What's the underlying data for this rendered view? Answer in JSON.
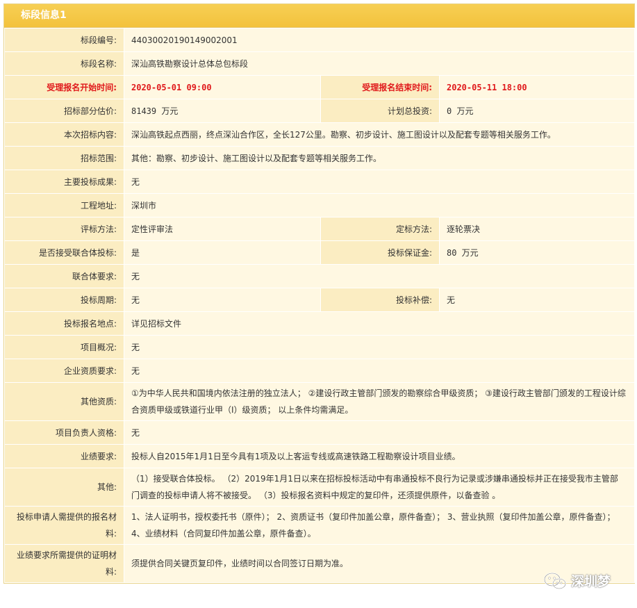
{
  "panel": {
    "title": "标段信息1"
  },
  "rows": [
    {
      "label": "标段编号:",
      "value": "44030020190149002001"
    },
    {
      "label": "标段名称:",
      "value": "深汕高铁勘察设计总体总包标段"
    },
    {
      "label": "受理报名开始时间:",
      "value": "2020-05-01  09:00",
      "label2": "受理报名结束时间:",
      "value2": "2020-05-11  18:00"
    },
    {
      "label": "招标部分估价:",
      "value": "81439 万元",
      "label2": "计划总投资:",
      "value2": "0 万元"
    },
    {
      "label": "本次招标内容:",
      "value": "深汕高铁起点西丽，终点深汕合作区，全长127公里。勘察、初步设计、施工图设计以及配套专题等相关服务工作。"
    },
    {
      "label": "招标范围:",
      "value": "其他：勘察、初步设计、施工图设计以及配套专题等相关服务工作。"
    },
    {
      "label": "主要投标成果:",
      "value": "无"
    },
    {
      "label": "工程地址:",
      "value": "深圳市"
    },
    {
      "label": "评标方法:",
      "value": "定性评审法",
      "label2": "定标方法:",
      "value2": "逐轮票决"
    },
    {
      "label": "是否接受联合体投标:",
      "value": "是",
      "label2": "投标保证金:",
      "value2": "80 万元"
    },
    {
      "label": "联合体要求:",
      "value": "无"
    },
    {
      "label": "投标周期:",
      "value": "无",
      "label2": "投标补偿:",
      "value2": "无"
    },
    {
      "label": "投标报名地点:",
      "value": "详见招标文件"
    },
    {
      "label": "项目概况:",
      "value": "无"
    },
    {
      "label": "企业资质要求:",
      "value": "无"
    },
    {
      "label": "其他资质:",
      "value": "①为中华人民共和国境内依法注册的独立法人；  ②建设行政主管部门颁发的勘察综合甲级资质；  ③建设行政主管部门颁发的工程设计综合资质甲级或铁道行业甲（Ⅰ）级资质；  以上条件均需满足。"
    },
    {
      "label": "项目负责人资格:",
      "value": "无"
    },
    {
      "label": "业绩要求:",
      "value": "投标人自2015年1月1日至今具有1项及以上客运专线或高速铁路工程勘察设计项目业绩。"
    },
    {
      "label": "其他:",
      "value": "（1）接受联合体投标。  （2）2019年1月1日以来在招标投标活动中有串通投标不良行为记录或涉嫌串通投标并正在接受我市主管部门调查的投标申请人将不被接受。  （3）投标报名资料中规定的复印件，还须提供原件，以备查验  。"
    },
    {
      "label": "投标申请人需提供的报名材料:",
      "value": "1、法人证明书，授权委托书（原件）；  2、资质证书（复印件加盖公章，原件备查）；  3、营业执照（复印件加盖公章，原件备查）；  4、业绩材料（合同复印件加盖公章，原件备查）。"
    },
    {
      "label": "业绩要求所需提供的证明材料:",
      "value": "须提供合同关键页复印件，业绩时间以合同签订日期为准。"
    }
  ],
  "watermark": {
    "text": "深圳梦",
    "icon": "wechat-icon"
  }
}
